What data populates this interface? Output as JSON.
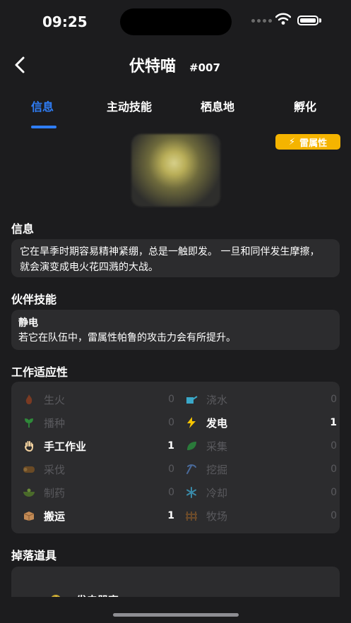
{
  "status": {
    "time": "09:25"
  },
  "header": {
    "title": "伏特喵",
    "number": "#007"
  },
  "tabs": [
    {
      "label": "信息",
      "active": true
    },
    {
      "label": "主动技能",
      "active": false
    },
    {
      "label": "栖息地",
      "active": false
    },
    {
      "label": "孵化",
      "active": false
    }
  ],
  "element_badge": {
    "label": "雷属性",
    "color": "#f5b400"
  },
  "info": {
    "title": "信息",
    "text": "它在旱季时期容易精神紧绷，总是一触即发。 一旦和同伴发生摩擦， 就会演变成电火花四溅的大战。"
  },
  "partner_skill": {
    "title": "伙伴技能",
    "name": "静电",
    "description": "若它在队伍中，雷属性帕鲁的攻击力会有所提升。"
  },
  "work": {
    "title": "工作适应性",
    "left": [
      {
        "icon": "flame-icon",
        "label": "生火",
        "value": "0"
      },
      {
        "icon": "sprout-icon",
        "label": "播种",
        "value": "0"
      },
      {
        "icon": "hand-icon",
        "label": "手工作业",
        "value": "1"
      },
      {
        "icon": "log-icon",
        "label": "采伐",
        "value": "0"
      },
      {
        "icon": "mortar-icon",
        "label": "制药",
        "value": "0"
      },
      {
        "icon": "box-icon",
        "label": "搬运",
        "value": "1"
      }
    ],
    "right": [
      {
        "icon": "watering-can-icon",
        "label": "浇水",
        "value": "0"
      },
      {
        "icon": "lightning-icon",
        "label": "发电",
        "value": "1"
      },
      {
        "icon": "leaf-icon",
        "label": "采集",
        "value": "0"
      },
      {
        "icon": "pickaxe-icon",
        "label": "挖掘",
        "value": "0"
      },
      {
        "icon": "snowflake-icon",
        "label": "冷却",
        "value": "0"
      },
      {
        "icon": "fence-icon",
        "label": "牧场",
        "value": "0"
      }
    ]
  },
  "drops": {
    "title": "掉落道具",
    "first_item": "发电器官"
  }
}
